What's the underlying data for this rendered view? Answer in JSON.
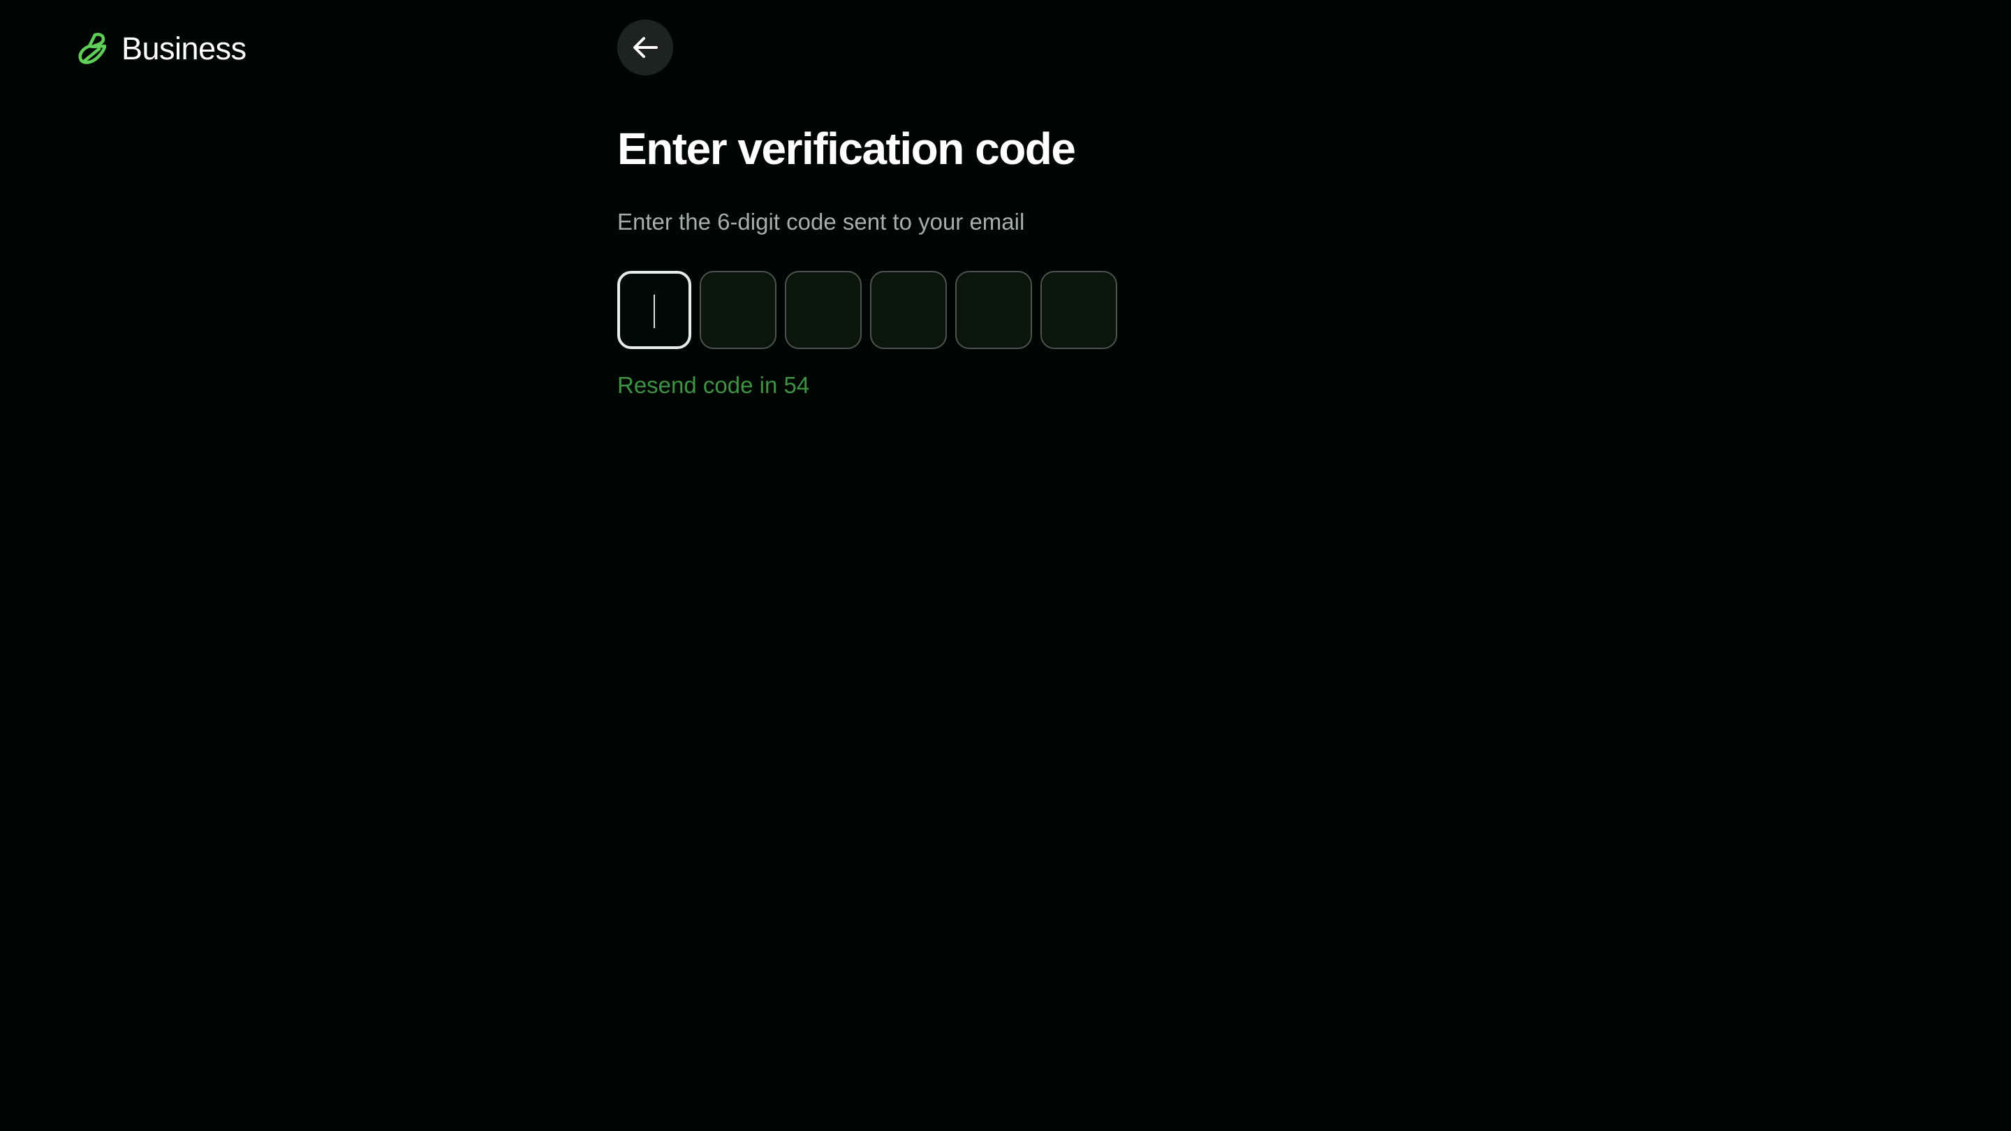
{
  "brand": {
    "name": "Business",
    "logo_icon": "business-leaf-logo-icon",
    "accent_color": "#5fcf5a"
  },
  "back_button": {
    "icon": "arrow-left-icon"
  },
  "heading": {
    "title": "Enter verification code",
    "subtitle": "Enter the 6-digit code sent to your email"
  },
  "otp": {
    "length": 6,
    "values": [
      "",
      "",
      "",
      "",
      "",
      ""
    ],
    "active_index": 0
  },
  "resend": {
    "text": "Resend code in 54",
    "color": "#3f9246"
  },
  "colors": {
    "background": "#020603",
    "cell_border": "#4d534f",
    "cell_active_border": "#e9ece9"
  }
}
